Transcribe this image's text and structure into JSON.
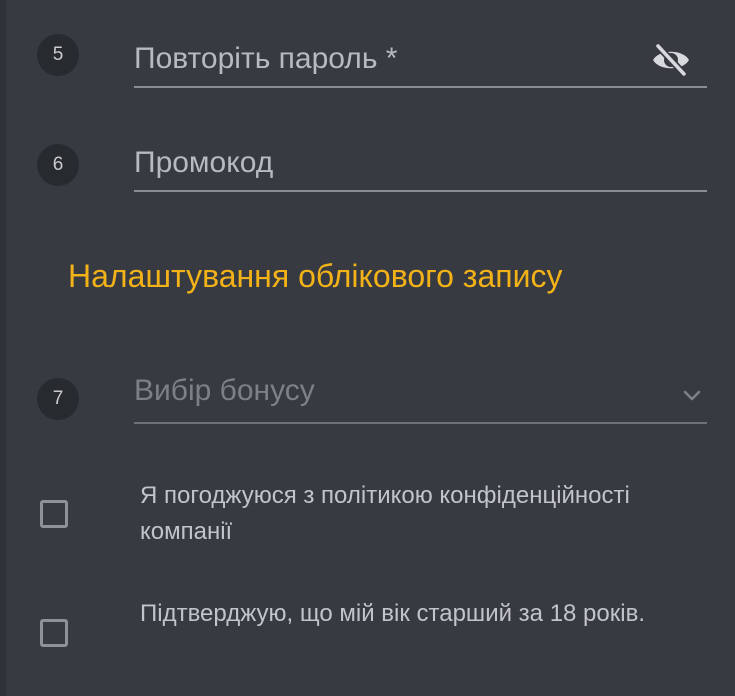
{
  "form": {
    "repeat_password": {
      "step": "5",
      "placeholder": "Повторіть пароль *",
      "toggle_icon": "eye-off-icon"
    },
    "promo_code": {
      "step": "6",
      "placeholder": "Промокод"
    },
    "section_title": "Налаштування облікового запису",
    "bonus_select": {
      "step": "7",
      "value": "Вибір бонусу",
      "icon": "chevron-down-icon"
    },
    "agreements": [
      {
        "label": "Я погоджуюся з політикою конфіденційності компанії",
        "checked": false
      },
      {
        "label": "Підтверджую, що мій вік старший за 18 років.",
        "checked": false
      }
    ]
  },
  "colors": {
    "background": "#373a41",
    "accent": "#f2b218",
    "badge": "#272a2f",
    "underline": "#8a8d93"
  }
}
